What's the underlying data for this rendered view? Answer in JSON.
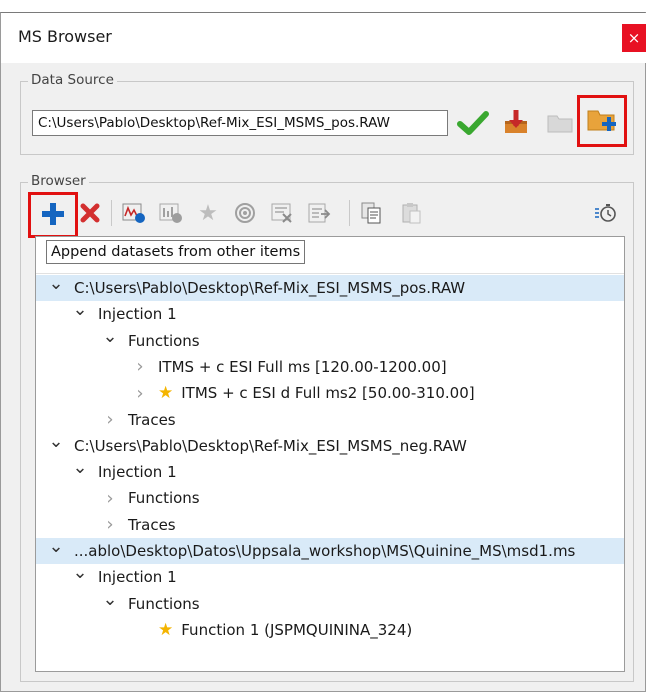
{
  "window": {
    "title": "MS Browser",
    "close_glyph": "×"
  },
  "data_source": {
    "group_label": "Data Source",
    "path_value": "C:\\Users\\Pablo\\Desktop\\Ref-Mix_ESI_MSMS_pos.RAW",
    "icons": [
      "check-icon",
      "import-icon",
      "folder-icon",
      "add-folder-icon"
    ]
  },
  "browser": {
    "group_label": "Browser",
    "toolbar_icons": [
      "append-plus-icon",
      "remove-x-icon",
      "spectrum-icon",
      "add-spectrum-icon",
      "favorite-star-icon",
      "target-icon",
      "filter-icon",
      "export-icon",
      "copy-icon",
      "paste-icon",
      "timer-icon"
    ],
    "tooltip": "Append datasets from other items",
    "tree": [
      {
        "label": "C:\\Users\\Pablo\\Desktop\\Ref-Mix_ESI_MSMS_pos.RAW",
        "level": 0,
        "expanded": true,
        "selected": true
      },
      {
        "label": "Injection 1",
        "level": 1,
        "expanded": true
      },
      {
        "label": "Functions",
        "level": 2,
        "expanded": true
      },
      {
        "label": "ITMS + c ESI Full ms [120.00-1200.00]",
        "level": 3,
        "expanded": false
      },
      {
        "label": "ITMS + c ESI d Full ms2 [50.00-310.00]",
        "level": 3,
        "expanded": false,
        "starred": true
      },
      {
        "label": "Traces",
        "level": 2,
        "expanded": false
      },
      {
        "label": "C:\\Users\\Pablo\\Desktop\\Ref-Mix_ESI_MSMS_neg.RAW",
        "level": 0,
        "expanded": true
      },
      {
        "label": "Injection 1",
        "level": 1,
        "expanded": true
      },
      {
        "label": "Functions",
        "level": 2,
        "expanded": false
      },
      {
        "label": "Traces",
        "level": 2,
        "expanded": false
      },
      {
        "label": "...ablo\\Desktop\\Datos\\Uppsala_workshop\\MS\\Quinine_MS\\msd1.ms",
        "level": 0,
        "expanded": true,
        "selected": true
      },
      {
        "label": "Injection 1",
        "level": 1,
        "expanded": true
      },
      {
        "label": "Functions",
        "level": 2,
        "expanded": true
      },
      {
        "label": "Function 1 (JSPMQUININA_324)",
        "level": 3,
        "expanded": null,
        "starred": true
      }
    ]
  },
  "colors": {
    "accent_blue": "#1565c0",
    "remove_red": "#d32f2f",
    "check_green": "#3aa830",
    "highlight_red": "#e11010",
    "selection": "#d9eaf8",
    "star": "#f4b400"
  }
}
